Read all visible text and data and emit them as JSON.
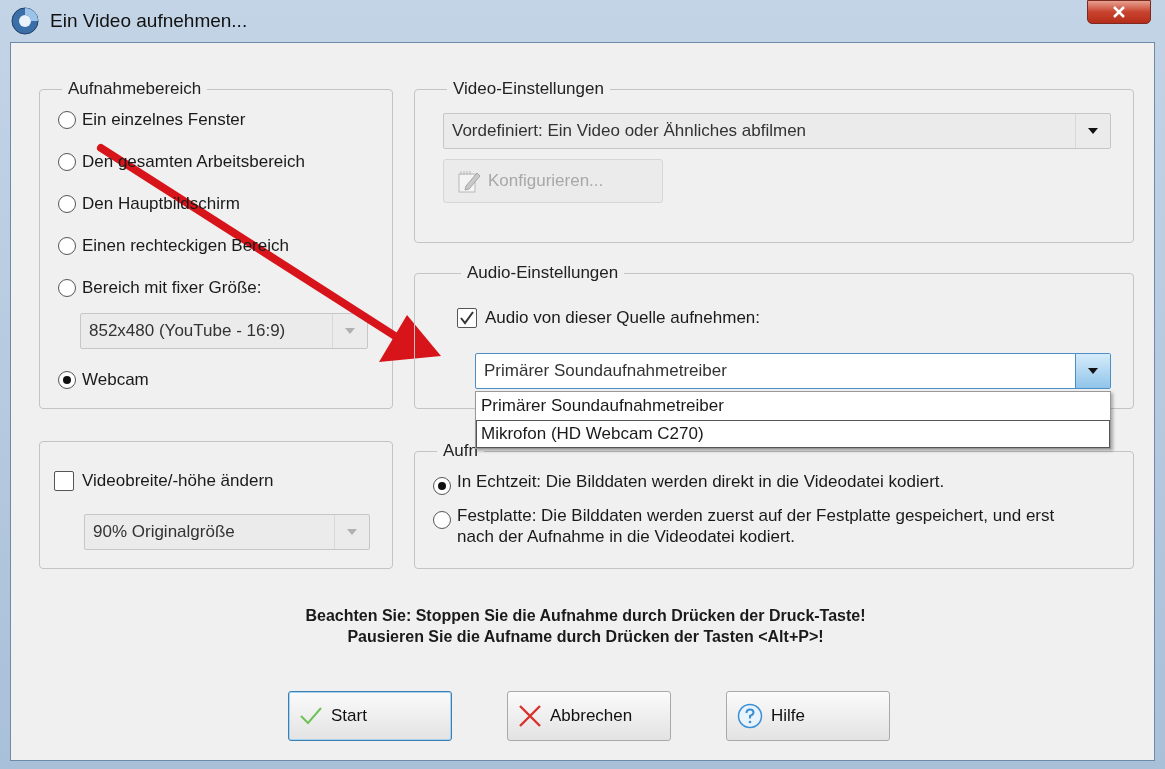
{
  "window": {
    "title": "Ein Video aufnehmen..."
  },
  "capture_area": {
    "title": "Aufnahmebereich",
    "items": [
      {
        "kind": "radio",
        "label": "Ein einzelnes Fenster",
        "selected": false
      },
      {
        "kind": "radio",
        "label": "Den gesamten Arbeitsbereich",
        "selected": false
      },
      {
        "kind": "radio",
        "label": "Den Hauptbildschirm",
        "selected": false
      },
      {
        "kind": "radio",
        "label": "Einen rechteckigen Bereich",
        "selected": false
      },
      {
        "kind": "radio",
        "label": "Bereich mit fixer Größe:",
        "selected": false
      },
      {
        "kind": "combo",
        "value": "852x480 (YouTube - 16:9)",
        "disabled": true
      },
      {
        "kind": "radio",
        "label": "Webcam",
        "selected": true
      }
    ]
  },
  "video_settings": {
    "title": "Video-Einstellungen",
    "preset": {
      "value": "Vordefiniert: Ein Video oder Ähnliches abfilmen"
    },
    "configure_button": {
      "label": "Konfigurieren...",
      "disabled": true
    }
  },
  "audio_settings": {
    "title": "Audio-Einstellungen",
    "record_checkbox": {
      "label": "Audio von dieser Quelle aufnehmen:",
      "checked": true
    },
    "source": {
      "value": "Primärer Soundaufnahmetreiber",
      "expanded": true,
      "options": [
        {
          "label": "Primärer Soundaufnahmetreiber",
          "highlighted": false
        },
        {
          "label": "Mikrofon (HD Webcam C270)",
          "highlighted": true
        }
      ]
    }
  },
  "resize": {
    "checkbox": {
      "label": "Videobreite/-höhe ändern",
      "checked": false
    },
    "size": {
      "value": "90% Originalgröße",
      "disabled": true
    }
  },
  "technique": {
    "title": "Aufn",
    "options": [
      {
        "label": "In Echtzeit: Die Bilddaten werden direkt in die Videodatei kodiert.",
        "selected": true
      },
      {
        "label": "Festplatte: Die Bilddaten werden zuerst auf der Festplatte gespeichert, und erst nach der Aufnahme in die Videodatei kodiert.",
        "selected": false
      }
    ]
  },
  "notice": [
    "Beachten Sie: Stoppen Sie die Aufnahme durch Drücken der Druck-Taste!",
    "Pausieren Sie die Aufname durch Drücken der Tasten <Alt+P>!"
  ],
  "buttons": [
    {
      "kind": "start",
      "label": "Start",
      "default": true
    },
    {
      "kind": "cancel",
      "label": "Abbrechen",
      "default": false
    },
    {
      "kind": "help",
      "label": "Hilfe",
      "default": false
    }
  ]
}
